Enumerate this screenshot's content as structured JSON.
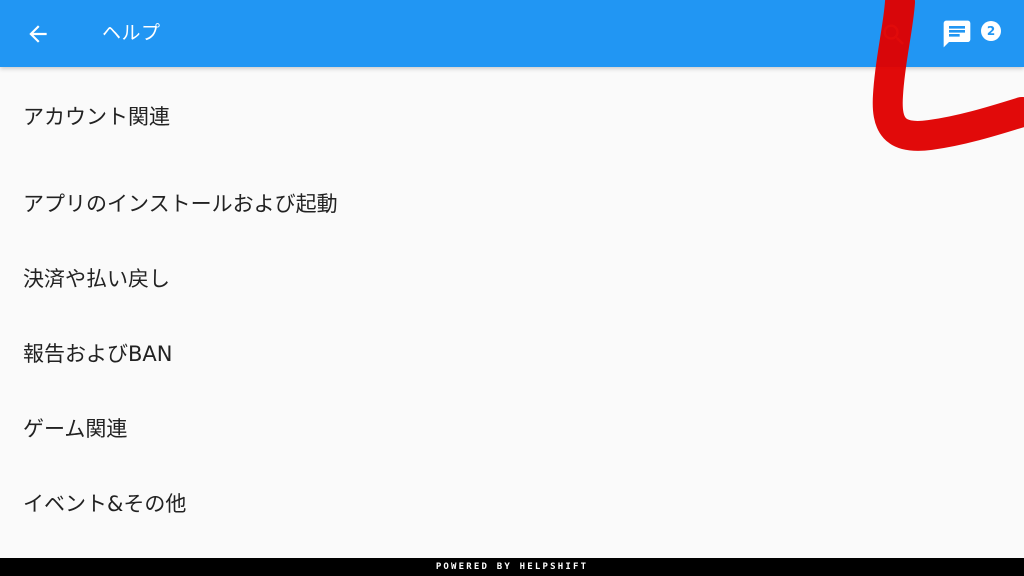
{
  "toolbar": {
    "title": "ヘルプ",
    "back_icon": "arrow-back-icon",
    "search_icon": "search-icon",
    "conversation_icon": "chat-icon",
    "conversation_badge": "2"
  },
  "faq_sections": [
    {
      "label": "アカウント関連"
    },
    {
      "label": "アプリのインストールおよび起動"
    },
    {
      "label": "決済や払い戻し"
    },
    {
      "label": "報告およびBAN"
    },
    {
      "label": "ゲーム関連"
    },
    {
      "label": "イベント&その他"
    }
  ],
  "footer": {
    "text": "POWERED BY HELPSHIFT"
  },
  "colors": {
    "toolbar": "#2196f3",
    "background": "#fafafa",
    "text": "#222222",
    "footer": "#000000",
    "annotation": "#e00000"
  }
}
